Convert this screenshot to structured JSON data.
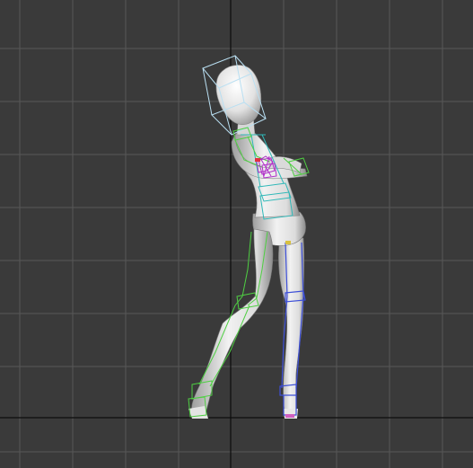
{
  "viewport": {
    "view": "perspective",
    "grid_visible": true,
    "background_color": "#3a3a3a",
    "grid_color": "#585858",
    "axis_color": "#0d0d0d",
    "scene_object": "biped-figure",
    "pose": "leaning-walk",
    "selection_box_color": "#b9dff2",
    "rig_colors": {
      "spine_torso": "#2fb8b8",
      "left_arm_leg": "#4fcf43",
      "right_leg": "#3d4fd8",
      "hands": "#b030c8",
      "shoulder_accent": "#e03040"
    }
  }
}
